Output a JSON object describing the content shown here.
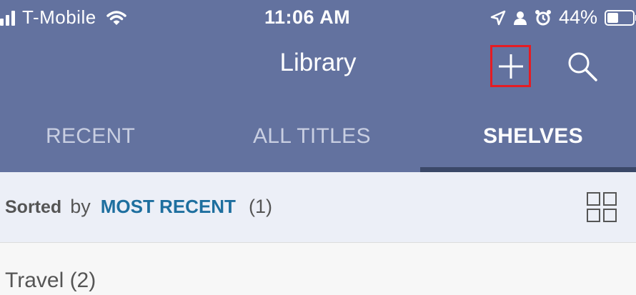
{
  "status_bar": {
    "carrier": "T-Mobile",
    "time": "11:06 AM",
    "battery_percent": "44%",
    "battery_level": 0.44,
    "icons": [
      "signal-icon",
      "wifi-icon",
      "location-icon",
      "person-icon",
      "alarm-icon",
      "battery-icon"
    ]
  },
  "header": {
    "title": "Library",
    "add_icon": "plus-icon",
    "search_icon": "search-icon",
    "highlight_color": "#e51c23",
    "background_color": "#63729f"
  },
  "tabs": [
    {
      "label": "RECENT",
      "active": false
    },
    {
      "label": "ALL TITLES",
      "active": false
    },
    {
      "label": "SHELVES",
      "active": true
    }
  ],
  "sort_bar": {
    "sorted_label": "Sorted",
    "by_label": "by",
    "mode": "MOST RECENT",
    "count": "(1)",
    "view_icon": "grid-view-icon",
    "accent_color": "#1e6f9f"
  },
  "shelves": [
    {
      "label": "Travel (2)"
    }
  ]
}
